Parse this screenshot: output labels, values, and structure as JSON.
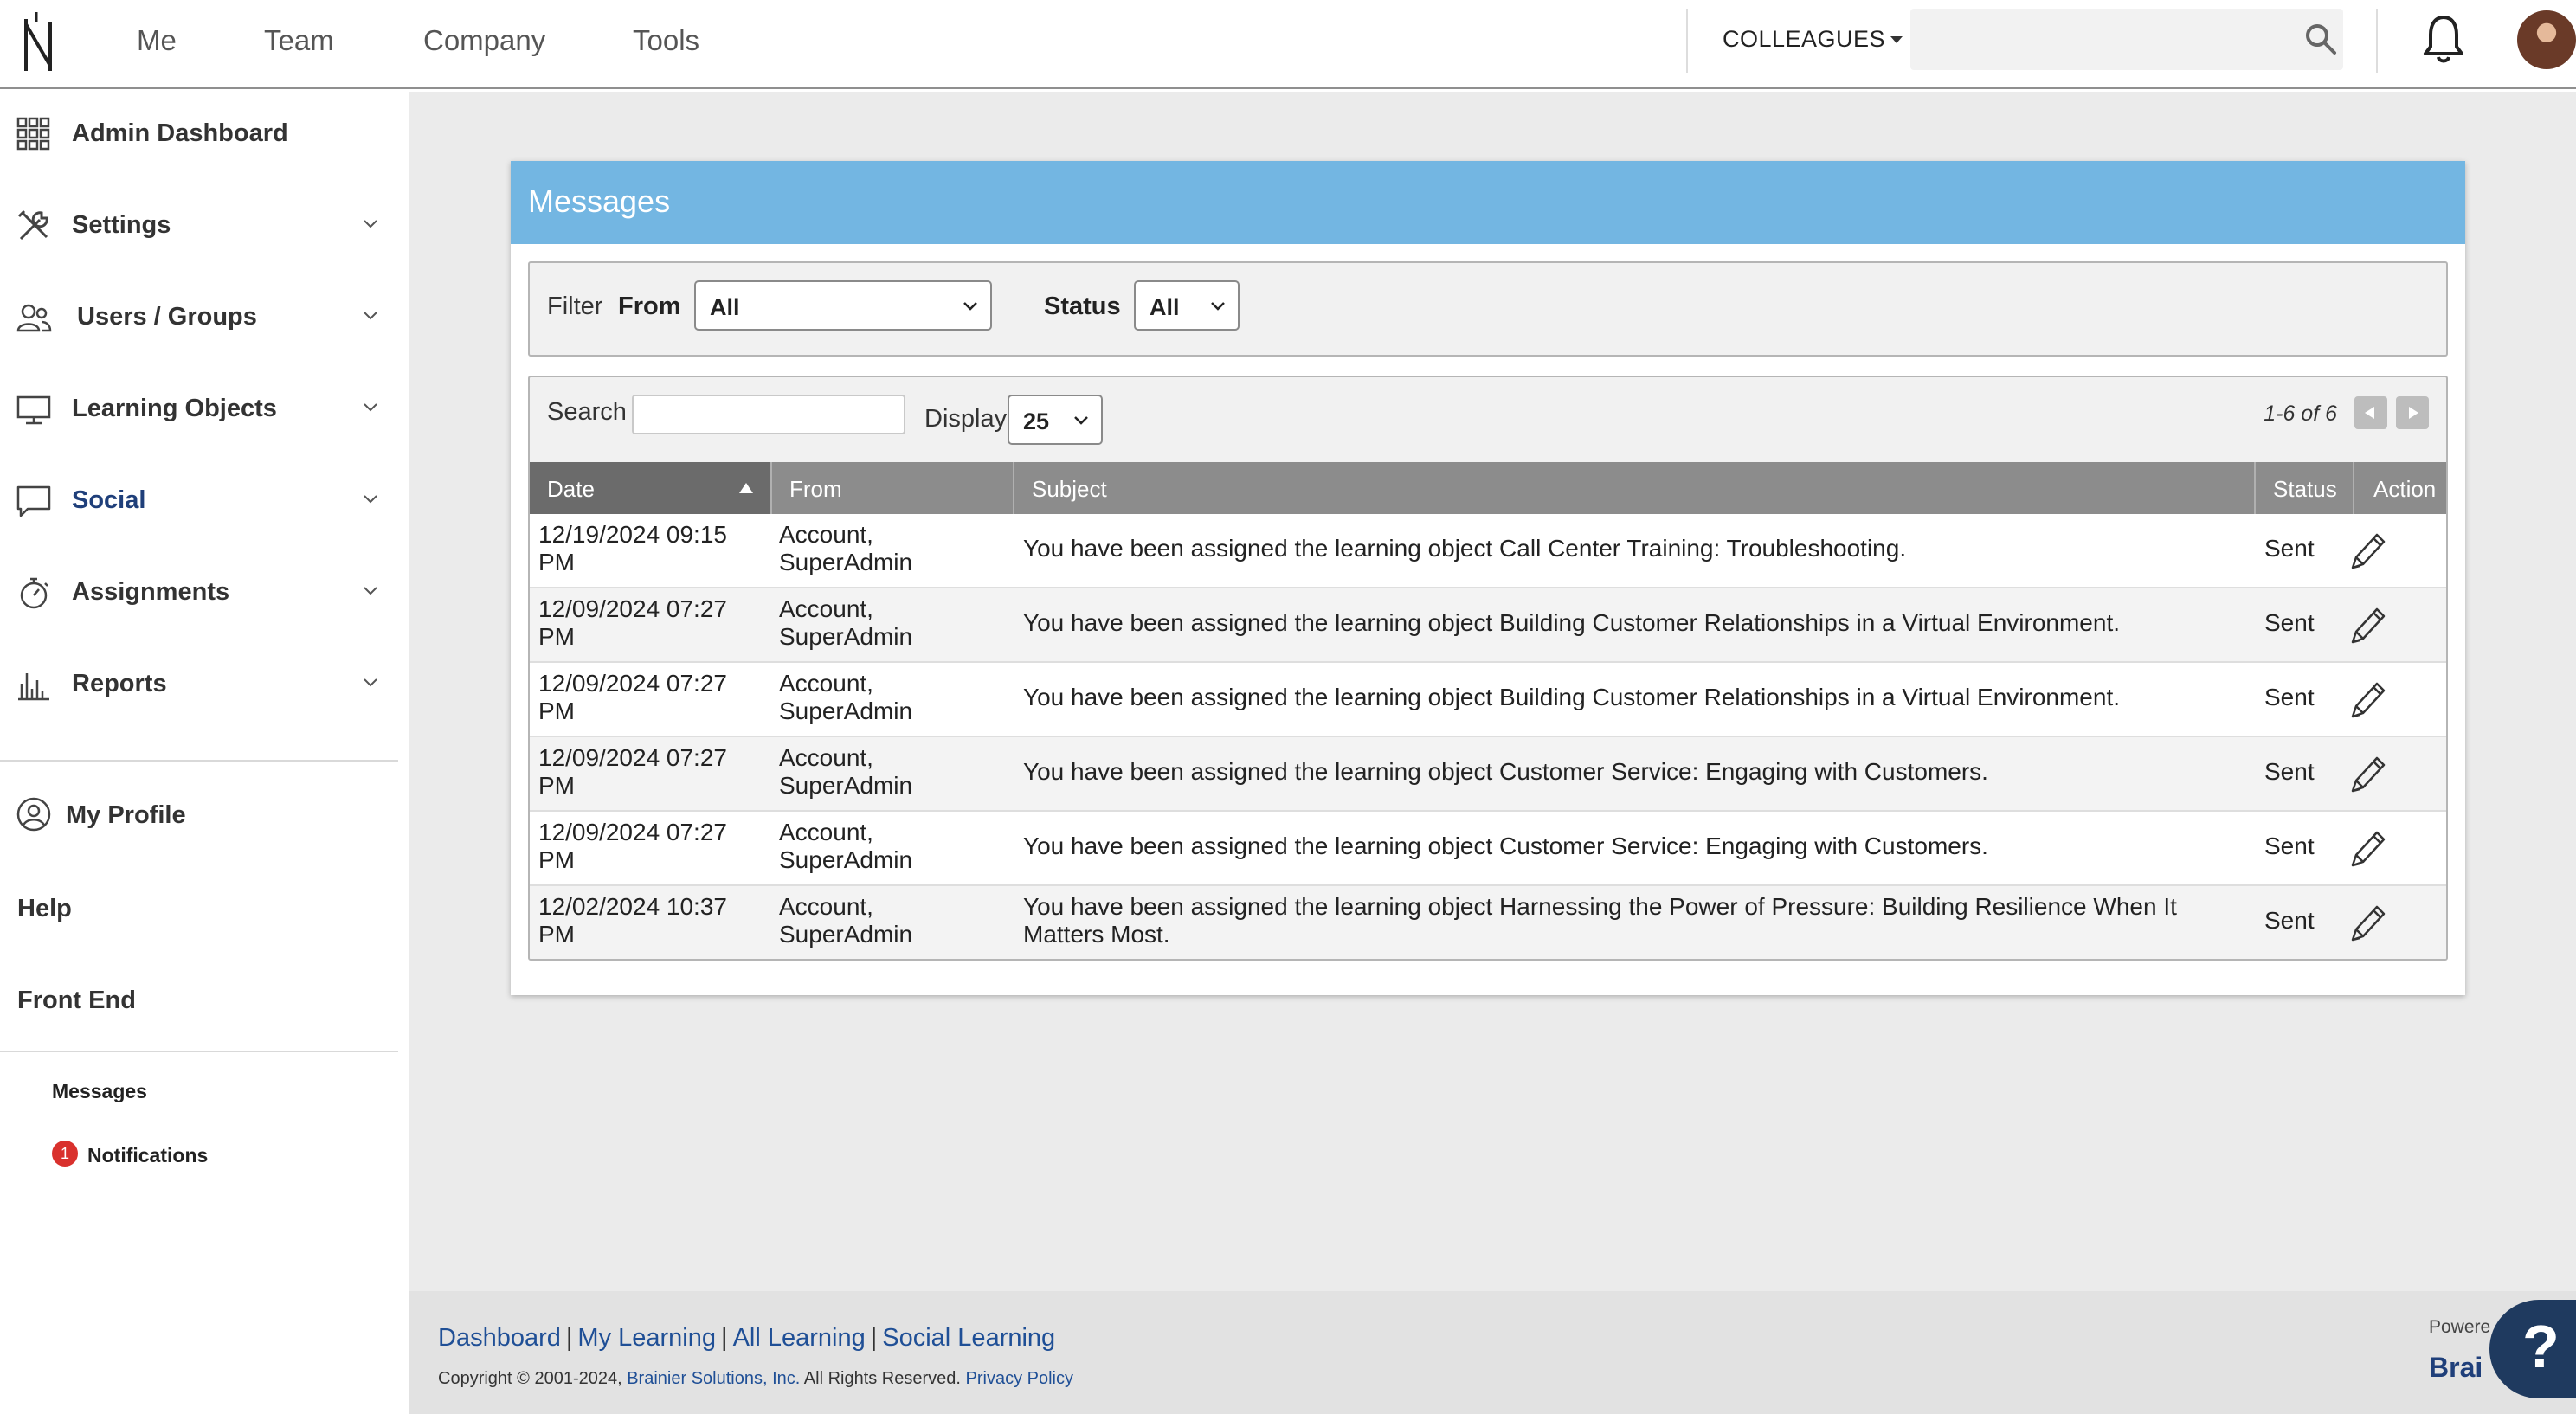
{
  "topnav": {
    "items": [
      "Me",
      "Team",
      "Company",
      "Tools"
    ],
    "colleagues_label": "COLLEAGUES",
    "search_placeholder": ""
  },
  "sidebar": {
    "items": [
      {
        "label": "Admin Dashboard",
        "icon": "grid-icon",
        "expandable": false
      },
      {
        "label": "Settings",
        "icon": "tools-icon",
        "expandable": true
      },
      {
        "label": "Users / Groups",
        "icon": "users-icon",
        "expandable": true
      },
      {
        "label": "Learning Objects",
        "icon": "monitor-icon",
        "expandable": true
      },
      {
        "label": "Social",
        "icon": "chat-icon",
        "expandable": true,
        "active": true
      },
      {
        "label": "Assignments",
        "icon": "stopwatch-icon",
        "expandable": true
      },
      {
        "label": "Reports",
        "icon": "bar-chart-icon",
        "expandable": true
      }
    ],
    "my_profile": "My Profile",
    "help": "Help",
    "front_end": "Front End",
    "sub_items": {
      "messages": "Messages",
      "notifications": "Notifications",
      "notifications_badge": "1"
    }
  },
  "panel": {
    "title": "Messages",
    "filter": {
      "filter_label": "Filter",
      "from_label": "From",
      "from_value": "All",
      "status_label": "Status",
      "status_value": "All"
    },
    "search_label": "Search",
    "search_value": "",
    "display_label": "Display",
    "display_value": "25",
    "pager_text": "1-6 of 6"
  },
  "table": {
    "columns": [
      "Date",
      "From",
      "Subject",
      "Status",
      "Action"
    ],
    "rows": [
      {
        "date_l1": "12/19/2024 09:15",
        "date_l2": "PM",
        "from_l1": "Account,",
        "from_l2": "SuperAdmin",
        "subject": "You have been assigned the learning object Call Center Training: Troubleshooting.",
        "subject_l2": "",
        "status": "Sent"
      },
      {
        "date_l1": "12/09/2024 07:27",
        "date_l2": "PM",
        "from_l1": "Account,",
        "from_l2": "SuperAdmin",
        "subject": "You have been assigned the learning object Building Customer Relationships in a Virtual Environment.",
        "subject_l2": "",
        "status": "Sent"
      },
      {
        "date_l1": "12/09/2024 07:27",
        "date_l2": "PM",
        "from_l1": "Account,",
        "from_l2": "SuperAdmin",
        "subject": "You have been assigned the learning object Building Customer Relationships in a Virtual Environment.",
        "subject_l2": "",
        "status": "Sent"
      },
      {
        "date_l1": "12/09/2024 07:27",
        "date_l2": "PM",
        "from_l1": "Account,",
        "from_l2": "SuperAdmin",
        "subject": "You have been assigned the learning object Customer Service: Engaging with Customers.",
        "subject_l2": "",
        "status": "Sent"
      },
      {
        "date_l1": "12/09/2024 07:27",
        "date_l2": "PM",
        "from_l1": "Account,",
        "from_l2": "SuperAdmin",
        "subject": "You have been assigned the learning object Customer Service: Engaging with Customers.",
        "subject_l2": "",
        "status": "Sent"
      },
      {
        "date_l1": "12/02/2024 10:37",
        "date_l2": "PM",
        "from_l1": "Account,",
        "from_l2": "SuperAdmin",
        "subject": "You have been assigned the learning object Harnessing the Power of Pressure: Building Resilience When It",
        "subject_l2": "Matters Most.",
        "status": "Sent"
      }
    ]
  },
  "footer": {
    "links": [
      "Dashboard",
      "My Learning",
      "All Learning",
      "Social Learning"
    ],
    "copyright_prefix": "Copyright © 2001-2024,",
    "company_link": "Brainier Solutions, Inc.",
    "rights": "All Rights Reserved.",
    "privacy_link": "Privacy Policy",
    "powered": "Powere",
    "brand": "Brai"
  },
  "colors": {
    "accent": "#73b6e2",
    "header_dark": "#8c8c8c",
    "link": "#1f4f96",
    "badge": "#d9312d"
  }
}
